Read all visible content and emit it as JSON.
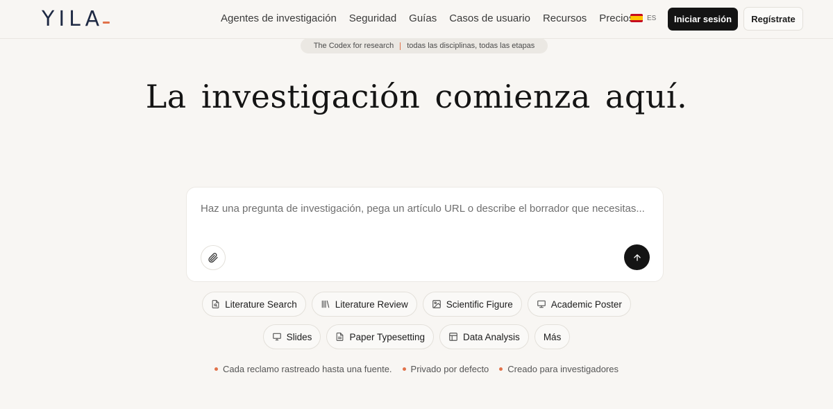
{
  "brand": {
    "logo_text": "YILA",
    "accent_color": "#e1724a"
  },
  "nav": {
    "items": [
      {
        "label": "Agentes de investigación"
      },
      {
        "label": "Seguridad"
      },
      {
        "label": "Guías"
      },
      {
        "label": "Casos de usuario"
      },
      {
        "label": "Recursos"
      },
      {
        "label": "Precios"
      }
    ],
    "language": {
      "code": "ES",
      "icon": "spain-flag-icon"
    },
    "login_label": "Iniciar sesión",
    "register_label": "Regístrate"
  },
  "banner": {
    "left": "The Codex for research",
    "right": "todas las disciplinas, todas las etapas"
  },
  "hero": {
    "title": "La investigación comienza aquí."
  },
  "prompt": {
    "placeholder": "Haz una pregunta de investigación, pega un artículo URL o describe el borrador que necesitas...",
    "value": "",
    "attach_icon": "paperclip-icon",
    "send_icon": "arrow-up-icon"
  },
  "tools": {
    "row1": [
      {
        "label": "Literature Search",
        "icon": "document-search-icon"
      },
      {
        "label": "Literature Review",
        "icon": "books-icon"
      },
      {
        "label": "Scientific Figure",
        "icon": "image-icon"
      },
      {
        "label": "Academic Poster",
        "icon": "presentation-icon"
      }
    ],
    "row2": [
      {
        "label": "Slides",
        "icon": "monitor-icon"
      },
      {
        "label": "Paper Typesetting",
        "icon": "document-icon"
      },
      {
        "label": "Data Analysis",
        "icon": "table-icon"
      },
      {
        "label": "Más",
        "icon": ""
      }
    ]
  },
  "features": [
    {
      "label": "Cada reclamo rastreado hasta una fuente."
    },
    {
      "label": "Privado por defecto"
    },
    {
      "label": "Creado para investigadores"
    }
  ]
}
